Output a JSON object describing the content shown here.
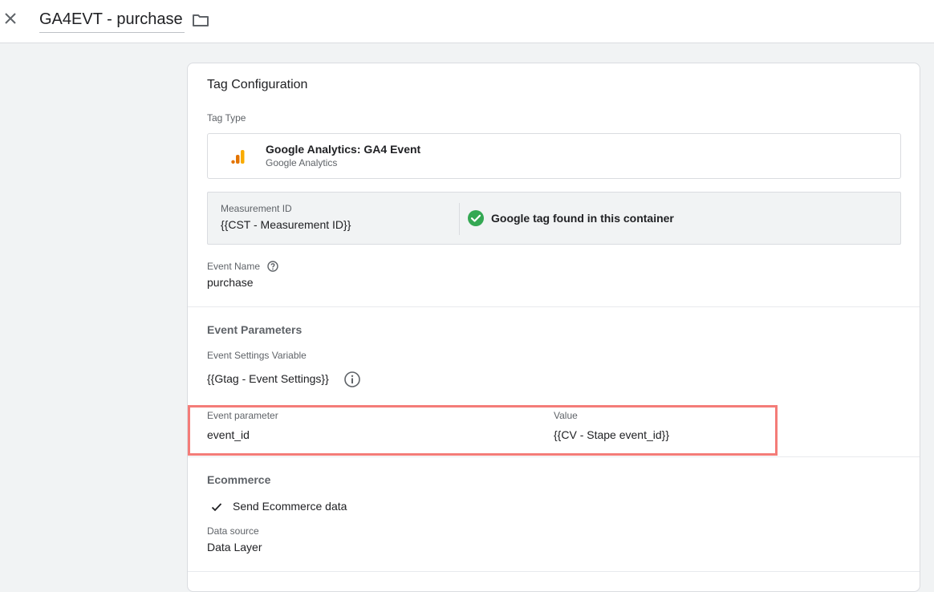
{
  "header": {
    "title": "GA4EVT - purchase"
  },
  "card": {
    "title": "Tag Configuration",
    "tag_type": {
      "label": "Tag Type",
      "name": "Google Analytics: GA4 Event",
      "subtitle": "Google Analytics"
    },
    "measurement": {
      "label": "Measurement ID",
      "value": "{{CST - Measurement ID}}",
      "status": "Google tag found in this container",
      "status_color": "#34a853"
    },
    "event_name": {
      "label": "Event Name",
      "value": "purchase"
    },
    "event_parameters": {
      "title": "Event Parameters",
      "settings_label": "Event Settings Variable",
      "settings_value": "{{Gtag - Event Settings}}",
      "header_param": "Event parameter",
      "header_value": "Value",
      "rows": [
        {
          "param": "event_id",
          "value": "{{CV - Stape event_id}}"
        }
      ]
    },
    "ecommerce": {
      "title": "Ecommerce",
      "send_label": "Send Ecommerce data",
      "data_source_label": "Data source",
      "data_source_value": "Data Layer"
    }
  },
  "colors": {
    "highlight": "#f47c78",
    "analytics_orange": "#f9ab00",
    "analytics_dark": "#e37400"
  },
  "icons": {
    "close": "close-icon",
    "folder": "folder-icon",
    "analytics": "google-analytics-icon",
    "check_circle": "check-circle-icon",
    "help": "help-icon",
    "info": "info-icon",
    "check": "check-icon"
  }
}
